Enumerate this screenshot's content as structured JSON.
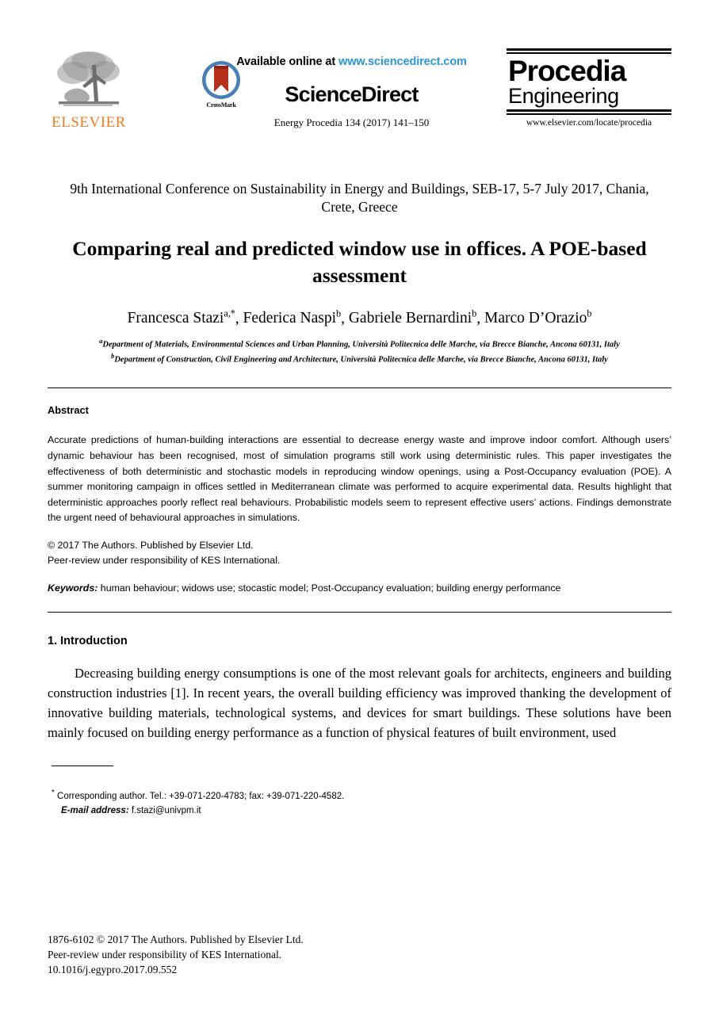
{
  "header": {
    "elsevier": {
      "wordmark": "ELSEVIER",
      "color": "#E87F24",
      "icon": "elsevier-tree-logo"
    },
    "crossmark": {
      "label": "CrossMark",
      "icon": "crossmark-badge-icon"
    },
    "sciencedirect": {
      "available_prefix": "Available online at ",
      "url": "www.sciencedirect.com",
      "url_color": "#2C96D4",
      "wordmark": "ScienceDirect",
      "journal_reference": "Energy Procedia 134 (2017) 141–150"
    },
    "procedia": {
      "line1": "Procedia",
      "line2": "Engineering",
      "url": "www.elsevier.com/locate/procedia"
    }
  },
  "conference": "9th International Conference on Sustainability in Energy and Buildings, SEB-17, 5-7 July 2017, Chania, Crete, Greece",
  "title": "Comparing real and predicted window use in offices. A POE-based assessment",
  "authors": [
    {
      "name": "Francesca Stazi",
      "sup": "a,*"
    },
    {
      "name": "Federica Naspi",
      "sup": "b"
    },
    {
      "name": "Gabriele Bernardini",
      "sup": "b"
    },
    {
      "name": "Marco D’Orazio",
      "sup": "b"
    }
  ],
  "affiliations": [
    {
      "marker": "a",
      "text": "Department of Materials, Environmental Sciences and Urban Planning, Università Politecnica delle Marche, via Brecce Bianche, Ancona 60131, Italy"
    },
    {
      "marker": "b",
      "text": "Department of Construction, Civil Engineering and Architecture, Università Politecnica delle Marche, via Brecce Bianche, Ancona 60131, Italy"
    }
  ],
  "abstract": {
    "heading": "Abstract",
    "body": "Accurate predictions of human-building interactions are essential to decrease energy waste and improve indoor comfort. Although users’ dynamic behaviour has been recognised, most of simulation programs still work using deterministic rules. This paper investigates the effectiveness of both deterministic and stochastic models in reproducing window openings, using a Post-Occupancy evaluation (POE). A summer monitoring campaign in offices settled in Mediterranean climate was performed to acquire experimental data. Results highlight that deterministic approaches poorly reflect real behaviours. Probabilistic models seem to represent effective users’ actions. Findings demonstrate the urgent need of behavioural approaches in simulations.",
    "copyright_line1": "© 2017 The Authors. Published by Elsevier Ltd.",
    "copyright_line2": "Peer-review under responsibility of KES International.",
    "keywords_label": "Keywords:",
    "keywords_text": " human behaviour; widows use; stocastic model; Post-Occupancy evaluation; building energy performance"
  },
  "section": {
    "heading": "1. Introduction",
    "paragraph": "Decreasing building energy consumptions is one of the most relevant goals for architects, engineers and building construction industries [1]. In recent years, the overall building efficiency was improved thanking the development of innovative building materials, technological systems, and devices for smart buildings. These solutions have been mainly focused on building energy performance as a function of physical features of built environment, used"
  },
  "footnote": {
    "star": "*",
    "corresponding": " Corresponding author. Tel.: +39-071-220-4783; fax: +39-071-220-4582.",
    "email_label": "E-mail address:",
    "email_value": " f.stazi@univpm.it"
  },
  "page_footer": {
    "line1": "1876-6102 © 2017 The Authors. Published by Elsevier Ltd.",
    "line2": "Peer-review under responsibility of KES International.",
    "line3": "10.1016/j.egypro.2017.09.552"
  }
}
